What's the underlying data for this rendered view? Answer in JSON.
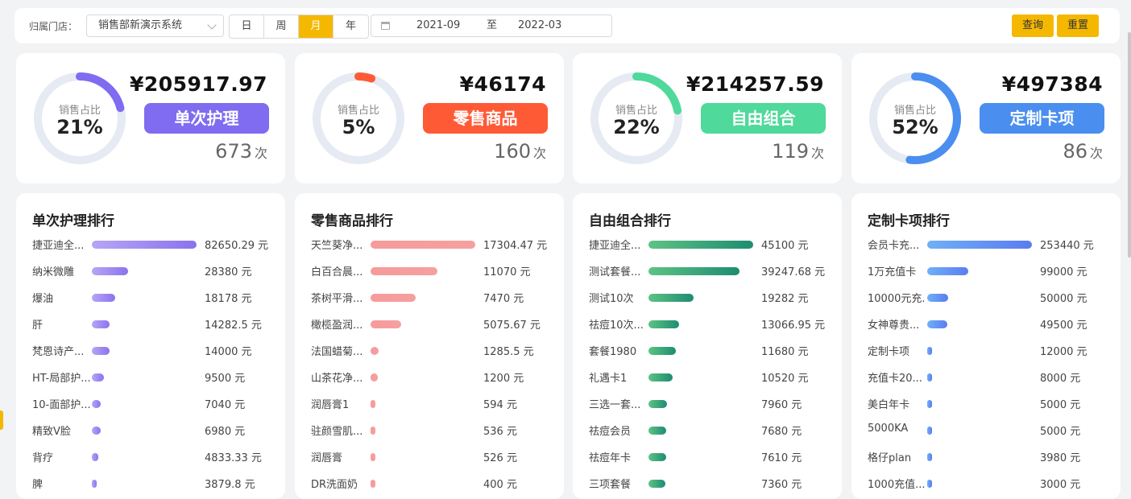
{
  "filter": {
    "store_label": "归属门店：",
    "store_value": "销售部新演示系统",
    "periods": [
      "日",
      "周",
      "月",
      "年"
    ],
    "active_period": "月",
    "date_start": "2021-09",
    "date_sep": "至",
    "date_end": "2022-03",
    "query_label": "查询",
    "reset_label": "重置"
  },
  "colors": {
    "accent": "#f5b800",
    "donut_track": "#e6eaf3",
    "purple": "#7f6cf0",
    "red": "#ff5a36",
    "green": "#4fd99a",
    "blue": "#4a8ef0"
  },
  "stats": [
    {
      "donut_label": "销售占比",
      "pct_text": "21%",
      "pct": 21,
      "amount": "¥205917.97",
      "category": "单次护理",
      "count": "673",
      "count_unit": "次",
      "color": "#7f6cf0"
    },
    {
      "donut_label": "销售占比",
      "pct_text": "5%",
      "pct": 5,
      "amount": "¥46174",
      "category": "零售商品",
      "count": "160",
      "count_unit": "次",
      "color": "#ff5a36"
    },
    {
      "donut_label": "销售占比",
      "pct_text": "22%",
      "pct": 22,
      "amount": "¥214257.59",
      "category": "自由组合",
      "count": "119",
      "count_unit": "次",
      "color": "#4fd99a"
    },
    {
      "donut_label": "销售占比",
      "pct_text": "52%",
      "pct": 52,
      "amount": "¥497384",
      "category": "定制卡项",
      "count": "86",
      "count_unit": "次",
      "color": "#4a8ef0"
    }
  ],
  "rankings": [
    {
      "title": "单次护理排行",
      "bar_colors": [
        "#b7a5f5",
        "#8a73ee"
      ],
      "items": [
        {
          "name": "捷亚迪全...",
          "value": 82650.29,
          "label": "82650.29 元"
        },
        {
          "name": "纳米微雕",
          "value": 28380,
          "label": "28380 元"
        },
        {
          "name": "爆油",
          "value": 18178,
          "label": "18178 元"
        },
        {
          "name": "肝",
          "value": 14282.5,
          "label": "14282.5 元"
        },
        {
          "name": "梵恩诗产...",
          "value": 14000,
          "label": "14000 元"
        },
        {
          "name": "HT-局部护...",
          "value": 9500,
          "label": "9500 元"
        },
        {
          "name": "10-面部护...",
          "value": 7040,
          "label": "7040 元"
        },
        {
          "name": "精致V脸",
          "value": 6980,
          "label": "6980 元"
        },
        {
          "name": "背疗",
          "value": 4833.33,
          "label": "4833.33 元"
        },
        {
          "name": "脾",
          "value": 3879.8,
          "label": "3879.8 元"
        }
      ]
    },
    {
      "title": "零售商品排行",
      "bar_colors": [
        "#f79a9a",
        "#f5a0a0"
      ],
      "items": [
        {
          "name": "天竺葵净...",
          "value": 17304.47,
          "label": "17304.47 元"
        },
        {
          "name": "白百合晨...",
          "value": 11070,
          "label": "11070 元"
        },
        {
          "name": "茶树平滑...",
          "value": 7470,
          "label": "7470 元"
        },
        {
          "name": "橄榄盈润...",
          "value": 5075.67,
          "label": "5075.67 元"
        },
        {
          "name": "法国蜡菊...",
          "value": 1285.5,
          "label": "1285.5 元"
        },
        {
          "name": "山茶花净...",
          "value": 1200,
          "label": "1200 元"
        },
        {
          "name": "润唇膏1",
          "value": 594,
          "label": "594 元"
        },
        {
          "name": "驻颜雪肌...",
          "value": 536,
          "label": "536 元"
        },
        {
          "name": "润唇膏",
          "value": 526,
          "label": "526 元"
        },
        {
          "name": "DR洗面奶",
          "value": 400,
          "label": "400 元"
        }
      ]
    },
    {
      "title": "自由组合排行",
      "bar_colors": [
        "#5cc383",
        "#1e8c72"
      ],
      "items": [
        {
          "name": "捷亚迪全...",
          "value": 45100,
          "label": "45100 元"
        },
        {
          "name": "测试套餐...",
          "value": 39247.68,
          "label": "39247.68 元"
        },
        {
          "name": "测试10次",
          "value": 19282,
          "label": "19282 元"
        },
        {
          "name": "祛痘10次...",
          "value": 13066.95,
          "label": "13066.95 元"
        },
        {
          "name": "套餐1980",
          "value": 11680,
          "label": "11680 元"
        },
        {
          "name": "礼遇卡1",
          "value": 10520,
          "label": "10520 元"
        },
        {
          "name": "三选一套...",
          "value": 7960,
          "label": "7960 元"
        },
        {
          "name": "祛痘会员",
          "value": 7680,
          "label": "7680 元"
        },
        {
          "name": "祛痘年卡",
          "value": 7610,
          "label": "7610 元"
        },
        {
          "name": "三项套餐",
          "value": 7360,
          "label": "7360 元"
        }
      ]
    },
    {
      "title": "定制卡项排行",
      "bar_colors": [
        "#6fb0f7",
        "#5b7cf0"
      ],
      "items": [
        {
          "name": "会员卡充...",
          "value": 253440,
          "label": "253440 元"
        },
        {
          "name": "1万充值卡",
          "value": 99000,
          "label": "99000 元"
        },
        {
          "name": "10000元充...",
          "value": 50000,
          "label": "50000 元"
        },
        {
          "name": "女神尊贵...",
          "value": 49500,
          "label": "49500 元"
        },
        {
          "name": "定制卡项",
          "value": 12000,
          "label": "12000 元"
        },
        {
          "name": "充值卡20...",
          "value": 8000,
          "label": "8000 元"
        },
        {
          "name": "美白年卡",
          "value": 5000,
          "label": "5000 元"
        },
        {
          "name": "5000KA",
          "value": 5000,
          "label": "5000 元"
        },
        {
          "name": "格仔plan",
          "value": 3980,
          "label": "3980 元"
        },
        {
          "name": "1000充值...",
          "value": 3000,
          "label": "3000 元"
        }
      ]
    }
  ]
}
